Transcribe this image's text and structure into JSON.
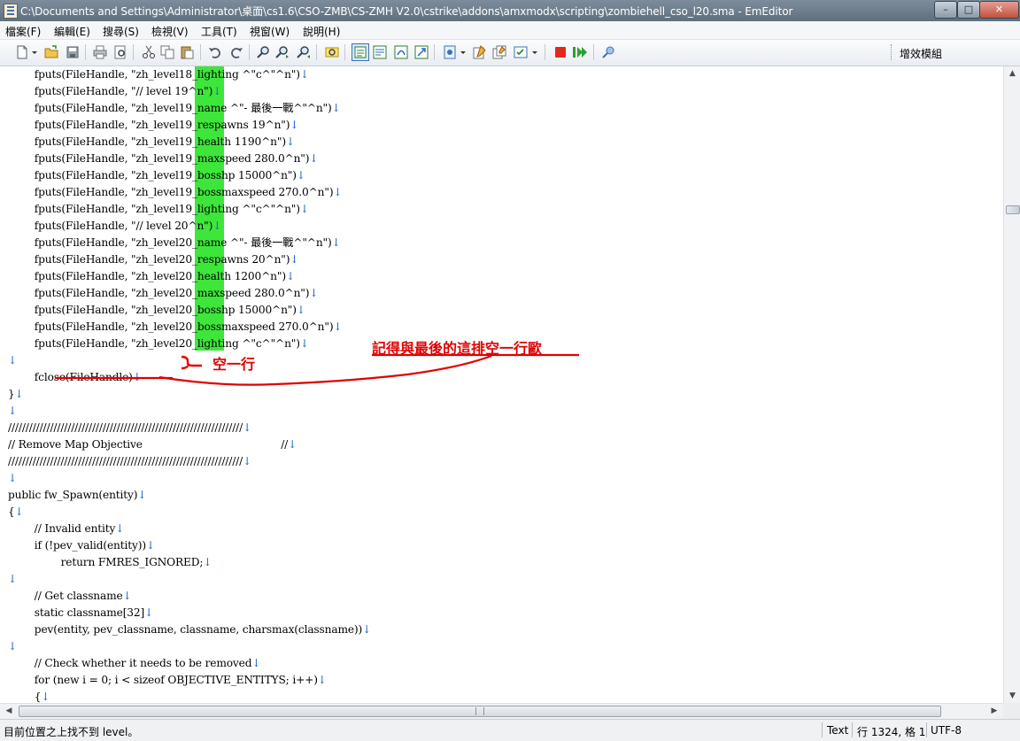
{
  "window": {
    "title": "C:\\Documents and Settings\\Administrator\\桌面\\cs1.6\\CSO-ZMB\\CS-ZMH V2.0\\cstrike\\addons\\amxmodx\\scripting\\zombiehell_cso_l20.sma - EmEditor",
    "min_glyph": "–",
    "max_glyph": "□",
    "close_glyph": "✕"
  },
  "menu": {
    "items": [
      "檔案(F)",
      "編輯(E)",
      "搜尋(S)",
      "檢視(V)",
      "工具(T)",
      "視窗(W)",
      "說明(H)"
    ]
  },
  "toolbar": {
    "icons": [
      "new-file-icon",
      "dropdown-arrow-icon",
      "open-folder-icon",
      "save-icon",
      "print-icon",
      "print-preview-icon",
      "cut-icon",
      "copy-icon",
      "paste-icon",
      "undo-icon",
      "redo-icon",
      "find-icon",
      "find-next-icon",
      "find-previous-icon",
      "highlight-icon",
      "view-mode-1-icon",
      "view-mode-2-icon",
      "view-mode-3-icon",
      "view-mode-4-icon",
      "macro-icon",
      "dropdown-arrow-icon",
      "properties-icon",
      "settings-icon",
      "checklist-icon",
      "dropdown-arrow-icon",
      "stop-record-icon",
      "play-macro-icon",
      "plugin-icon"
    ],
    "plugin_label": "增效模組"
  },
  "editor": {
    "return_glyph": "↓",
    "lines": [
      "        fputs(FileHandle, \"zh_level18_lighting ^\"c^\"^n\")",
      "        fputs(FileHandle, \"// level 19^n\")",
      "        fputs(FileHandle, \"zh_level19_name ^\"- 最後一戰^\"^n\")",
      "        fputs(FileHandle, \"zh_level19_respawns 19^n\")",
      "        fputs(FileHandle, \"zh_level19_health 1190^n\")",
      "        fputs(FileHandle, \"zh_level19_maxspeed 280.0^n\")",
      "        fputs(FileHandle, \"zh_level19_bosshp 15000^n\")",
      "        fputs(FileHandle, \"zh_level19_bossmaxspeed 270.0^n\")",
      "        fputs(FileHandle, \"zh_level19_lighting ^\"c^\"^n\")",
      "        fputs(FileHandle, \"// level 20^n\")",
      "        fputs(FileHandle, \"zh_level20_name ^\"- 最後一戰^\"^n\")",
      "        fputs(FileHandle, \"zh_level20_respawns 20^n\")",
      "        fputs(FileHandle, \"zh_level20_health 1200^n\")",
      "        fputs(FileHandle, \"zh_level20_maxspeed 280.0^n\")",
      "        fputs(FileHandle, \"zh_level20_bosshp 15000^n\")",
      "        fputs(FileHandle, \"zh_level20_bossmaxspeed 270.0^n\")",
      "        fputs(FileHandle, \"zh_level20_lighting ^\"c^\"^n\")",
      "",
      "        fclose(FileHandle)",
      "}",
      "",
      "///////////////////////////////////////////////////////////////////",
      "// Remove Map Objective                                          //",
      "///////////////////////////////////////////////////////////////////",
      "",
      "public fw_Spawn(entity)",
      "{",
      "        // Invalid entity",
      "        if (!pev_valid(entity))",
      "                return FMRES_IGNORED;",
      "",
      "        // Get classname",
      "        static classname[32]",
      "        pev(entity, pev_classname, classname, charsmax(classname))",
      "",
      "        // Check whether it needs to be removed",
      "        for (new i = 0; i < sizeof OBJECTIVE_ENTITYS; i++)",
      "        {"
    ]
  },
  "annotations": {
    "blank_line_note": "空一行",
    "keep_blank_note": "記得與最後的這排空一行歐"
  },
  "status": {
    "message": "目前位置之上找不到 level。",
    "mode": "Text",
    "position": "行 1324, 格 1",
    "encoding": "UTF-8"
  },
  "colors": {
    "highlight": "#3ee63b",
    "annotation": "#e00000",
    "return_mark": "#1b5fd0"
  }
}
